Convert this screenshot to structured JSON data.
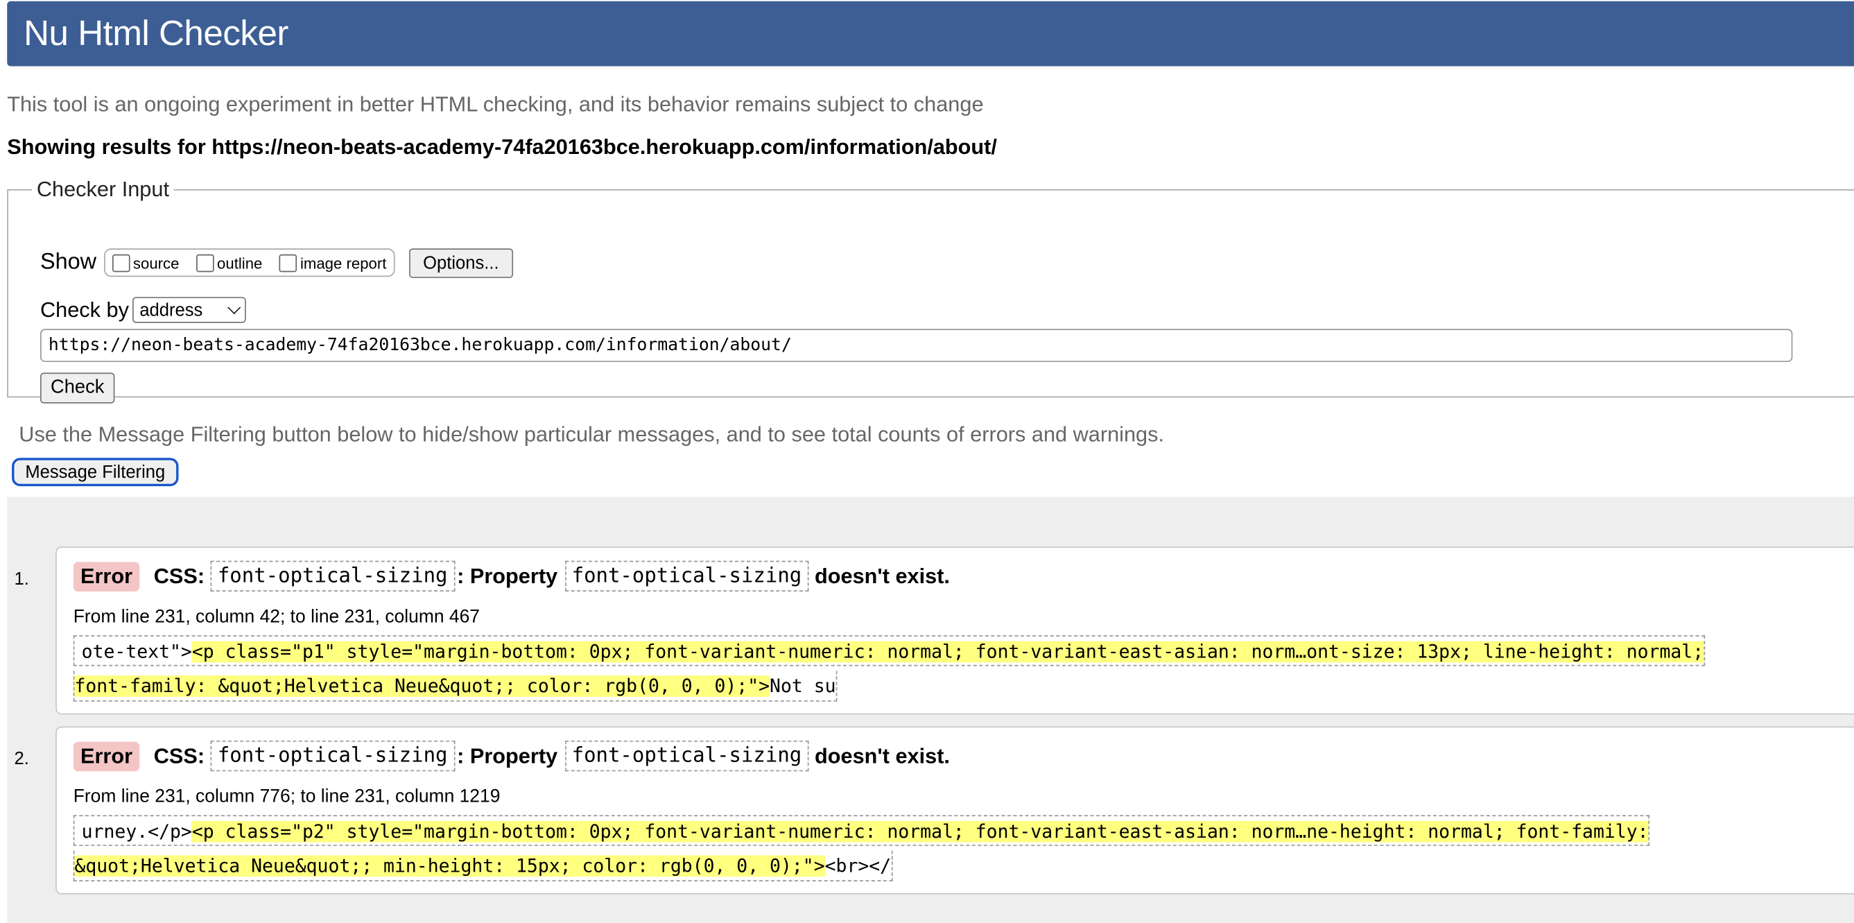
{
  "header": {
    "title": "Nu Html Checker"
  },
  "intro": "This tool is an ongoing experiment in better HTML checking, and its behavior remains subject to change",
  "showing": {
    "prefix": "Showing results for ",
    "url": "https://neon-beats-academy-74fa20163bce.herokuapp.com/information/about/"
  },
  "checker_input": {
    "legend": "Checker Input",
    "show_label": "Show",
    "checkboxes": [
      {
        "label": "source",
        "checked": false
      },
      {
        "label": "outline",
        "checked": false
      },
      {
        "label": "image report",
        "checked": false
      }
    ],
    "options_button": "Options...",
    "check_by_label": "Check by",
    "check_by_value": "address",
    "url_value": "https://neon-beats-academy-74fa20163bce.herokuapp.com/information/about/",
    "check_button": "Check"
  },
  "filtering": {
    "note": "Use the Message Filtering button below to hide/show particular messages, and to see total counts of errors and warnings.",
    "button": "Message Filtering"
  },
  "messages": [
    {
      "number": "1.",
      "type": "Error",
      "lang": "CSS:",
      "property": "font-optical-sizing",
      "mid_text": ": Property",
      "property2": "font-optical-sizing",
      "end_text": "doesn't exist.",
      "location": "From line 231, column 42; to line 231, column 467",
      "extract_line1_pre": "ote-text\">",
      "extract_line1_hl": "<p class=\"p1\" style=\"margin-bottom: 0px; font-variant-numeric: normal; font-variant-east-asian: norm…ont-size: 13px; line-height: normal;",
      "extract_line2_hl": "font-family: &quot;Helvetica Neue&quot;; color: rgb(0, 0, 0);\">",
      "extract_line2_post": "Not su"
    },
    {
      "number": "2.",
      "type": "Error",
      "lang": "CSS:",
      "property": "font-optical-sizing",
      "mid_text": ": Property",
      "property2": "font-optical-sizing",
      "end_text": "doesn't exist.",
      "location": "From line 231, column 776; to line 231, column 1219",
      "extract_line1_pre": "urney.</p>",
      "extract_line1_hl": "<p class=\"p2\" style=\"margin-bottom: 0px; font-variant-numeric: normal; font-variant-east-asian: norm…ne-height: normal; font-family:",
      "extract_line2_hl": "&quot;Helvetica Neue&quot;; min-height: 15px; color: rgb(0, 0, 0);\">",
      "extract_line2_post": "<br></"
    }
  ]
}
